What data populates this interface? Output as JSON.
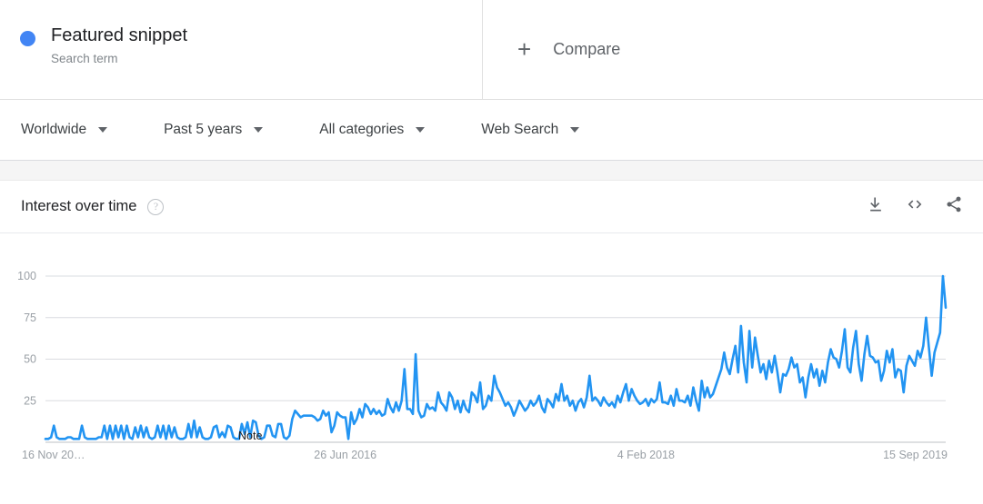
{
  "term": {
    "title": "Featured snippet",
    "subtitle": "Search term",
    "dot_color": "#4285f4"
  },
  "compare": {
    "plus": "+",
    "label": "Compare"
  },
  "filters": [
    {
      "label": "Worldwide",
      "name": "location-filter"
    },
    {
      "label": "Past 5 years",
      "name": "time-range-filter"
    },
    {
      "label": "All categories",
      "name": "category-filter"
    },
    {
      "label": "Web Search",
      "name": "search-type-filter"
    }
  ],
  "card": {
    "title": "Interest over time",
    "help": "?",
    "actions": [
      {
        "name": "download-icon",
        "label": "Download"
      },
      {
        "name": "embed-code-icon",
        "label": "Embed"
      },
      {
        "name": "share-icon",
        "label": "Share"
      }
    ]
  },
  "annotation": {
    "note": "Note"
  },
  "chart_data": {
    "type": "line",
    "title": "Interest over time",
    "xlabel": "",
    "ylabel": "",
    "ylim": [
      0,
      100
    ],
    "yticks": [
      25,
      50,
      75,
      100
    ],
    "ytick_labels": [
      "25",
      "50",
      "75",
      "100"
    ],
    "grid": true,
    "legend": false,
    "line_color": "#2294f2",
    "xtick_labels": [
      "16 Nov 20…",
      "26 Jun 2016",
      "4 Feb 2018",
      "15 Sep 2019"
    ],
    "xtick_positions": [
      0,
      0.333,
      0.667,
      1.0
    ],
    "series_name": "Featured snippet",
    "values": [
      2,
      2,
      3,
      10,
      3,
      2,
      2,
      2,
      3,
      3,
      2,
      2,
      2,
      10,
      3,
      2,
      2,
      2,
      2,
      3,
      3,
      10,
      2,
      10,
      2,
      10,
      3,
      10,
      2,
      10,
      3,
      2,
      9,
      3,
      10,
      3,
      9,
      3,
      2,
      3,
      10,
      3,
      10,
      2,
      10,
      3,
      9,
      3,
      2,
      2,
      3,
      11,
      3,
      13,
      3,
      9,
      3,
      2,
      2,
      3,
      9,
      10,
      3,
      6,
      3,
      10,
      9,
      3,
      2,
      2,
      11,
      5,
      12,
      3,
      13,
      12,
      4,
      2,
      3,
      10,
      10,
      4,
      3,
      11,
      11,
      3,
      2,
      4,
      14,
      19,
      17,
      15,
      16,
      16,
      16,
      16,
      15,
      13,
      14,
      19,
      16,
      18,
      6,
      10,
      18,
      16,
      15,
      15,
      2,
      18,
      11,
      14,
      20,
      15,
      23,
      21,
      17,
      20,
      17,
      19,
      16,
      17,
      26,
      21,
      18,
      24,
      19,
      25,
      44,
      20,
      20,
      17,
      53,
      19,
      15,
      16,
      23,
      20,
      21,
      19,
      30,
      24,
      22,
      19,
      30,
      27,
      20,
      25,
      18,
      25,
      20,
      18,
      30,
      28,
      24,
      36,
      20,
      22,
      28,
      25,
      40,
      33,
      30,
      26,
      22,
      24,
      21,
      16,
      20,
      25,
      22,
      19,
      21,
      25,
      22,
      24,
      28,
      21,
      18,
      26,
      24,
      21,
      29,
      25,
      35,
      25,
      28,
      22,
      25,
      19,
      24,
      26,
      21,
      27,
      40,
      25,
      27,
      25,
      22,
      27,
      24,
      22,
      24,
      21,
      28,
      24,
      30,
      35,
      25,
      32,
      28,
      25,
      23,
      24,
      26,
      22,
      26,
      24,
      26,
      36,
      24,
      24,
      23,
      28,
      22,
      32,
      25,
      25,
      24,
      28,
      22,
      33,
      25,
      19,
      37,
      27,
      33,
      27,
      29,
      34,
      39,
      44,
      54,
      45,
      41,
      50,
      58,
      42,
      70,
      48,
      36,
      67,
      45,
      63,
      52,
      42,
      47,
      38,
      49,
      42,
      52,
      42,
      30,
      41,
      40,
      44,
      51,
      45,
      47,
      36,
      39,
      27,
      39,
      47,
      39,
      44,
      34,
      43,
      36,
      48,
      56,
      51,
      50,
      45,
      55,
      68,
      45,
      42,
      57,
      67,
      47,
      37,
      53,
      64,
      52,
      51,
      48,
      49,
      37,
      43,
      55,
      48,
      56,
      39,
      44,
      43,
      30,
      46,
      52,
      49,
      46,
      55,
      51,
      58,
      75,
      57,
      40,
      54,
      60,
      66,
      100,
      81
    ]
  }
}
